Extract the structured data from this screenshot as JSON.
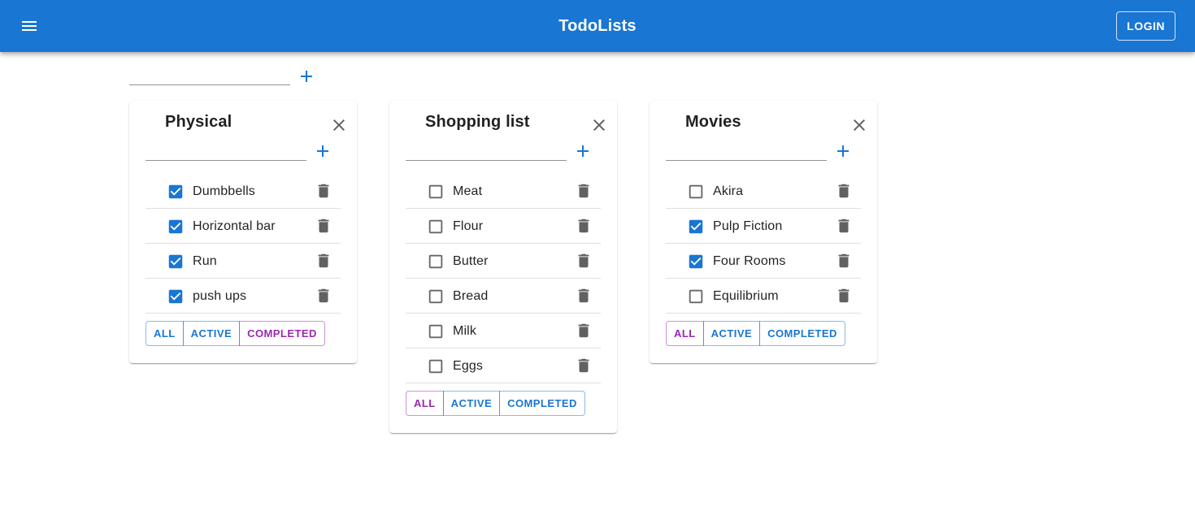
{
  "app": {
    "title": "TodoLists",
    "login_label": "LOGIN",
    "add_list_value": "",
    "add_list_placeholder": ""
  },
  "colors": {
    "primary": "#1976d2",
    "secondary": "#9c27b0",
    "icon_gray": "#757575"
  },
  "icons": {
    "menu": "menu-icon",
    "add": "plus-icon",
    "close": "close-icon",
    "delete": "trash-icon",
    "checked": "checkbox-checked-icon",
    "unchecked": "checkbox-unchecked-icon"
  },
  "lists": [
    {
      "title": "Physical",
      "new_task_value": "",
      "filter_selected": "completed",
      "filters": [
        "ALL",
        "ACTIVE",
        "COMPLETED"
      ],
      "tasks": [
        {
          "label": "Dumbbells",
          "done": true
        },
        {
          "label": "Horizontal bar",
          "done": true
        },
        {
          "label": "Run",
          "done": true
        },
        {
          "label": "push ups",
          "done": true
        }
      ]
    },
    {
      "title": "Shopping list",
      "new_task_value": "",
      "filter_selected": "all",
      "filters": [
        "ALL",
        "ACTIVE",
        "COMPLETED"
      ],
      "tasks": [
        {
          "label": "Meat",
          "done": false
        },
        {
          "label": "Flour",
          "done": false
        },
        {
          "label": "Butter",
          "done": false
        },
        {
          "label": "Bread",
          "done": false
        },
        {
          "label": "Milk",
          "done": false
        },
        {
          "label": "Eggs",
          "done": false
        }
      ]
    },
    {
      "title": "Movies",
      "new_task_value": "",
      "filter_selected": "all",
      "filters": [
        "ALL",
        "ACTIVE",
        "COMPLETED"
      ],
      "tasks": [
        {
          "label": "Akira",
          "done": false
        },
        {
          "label": "Pulp Fiction",
          "done": true
        },
        {
          "label": "Four Rooms",
          "done": true
        },
        {
          "label": "Equilibrium",
          "done": false
        }
      ]
    }
  ]
}
